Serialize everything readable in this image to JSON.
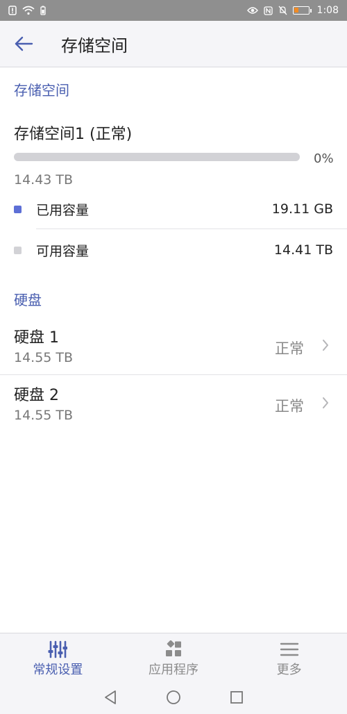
{
  "status_bar": {
    "time": "1:08",
    "left_icons": [
      "sim-alert-icon",
      "wifi-icon",
      "battery-saver-icon"
    ],
    "right_icons": [
      "eye-icon",
      "nfc-icon",
      "mute-icon",
      "battery-icon"
    ]
  },
  "app_bar": {
    "title": "存储空间",
    "back_icon": "arrow-left-icon"
  },
  "storage_section": {
    "header": "存储空间",
    "pool": {
      "title": "存储空间1 (正常)",
      "used_percent_label": "0%",
      "used_fraction": 0.0,
      "total": "14.43 TB"
    },
    "legend": [
      {
        "label": "已用容量",
        "value": "19.11 GB",
        "color": "#5d6fd6"
      },
      {
        "label": "可用容量",
        "value": "14.41 TB",
        "color": "#d2d2d6"
      }
    ]
  },
  "disk_section": {
    "header": "硬盘",
    "disks": [
      {
        "name": "硬盘 1",
        "size": "14.55 TB",
        "status": "正常"
      },
      {
        "name": "硬盘 2",
        "size": "14.55 TB",
        "status": "正常"
      }
    ]
  },
  "bottom_nav": {
    "items": [
      {
        "label": "常规设置",
        "icon": "sliders-icon",
        "active": true
      },
      {
        "label": "应用程序",
        "icon": "apps-grid-icon",
        "active": false
      },
      {
        "label": "更多",
        "icon": "menu-lines-icon",
        "active": false
      }
    ]
  },
  "colors": {
    "accent": "#4a5fb0",
    "used": "#5d6fd6",
    "free": "#d2d2d6"
  }
}
